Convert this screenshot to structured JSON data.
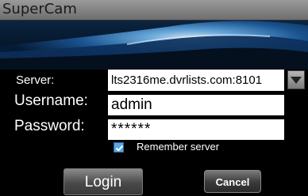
{
  "app": {
    "title": "SuperCam"
  },
  "form": {
    "server_label": "Server:",
    "server_value": "lts2316me.dvrlists.com:8101",
    "username_label": "Username:",
    "username_value": "admin",
    "password_label": "Password:",
    "password_value": "******",
    "remember_label": "Remember server",
    "remember_checked": true
  },
  "buttons": {
    "login": "Login",
    "cancel": "Cancel"
  },
  "icons": {
    "dropdown": "chevron-down-icon",
    "checkbox": "check-icon"
  },
  "colors": {
    "titlebar": "#8a8a8a",
    "checkbox": "#5aa6e0",
    "background": "#000000"
  }
}
